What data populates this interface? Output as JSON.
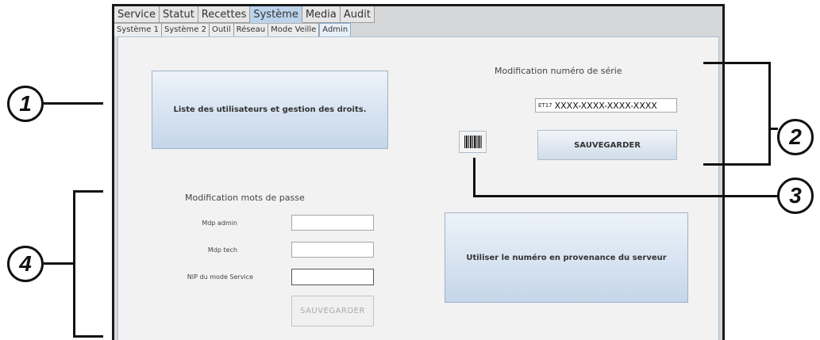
{
  "main_tabs": [
    {
      "label": "Service"
    },
    {
      "label": "Statut"
    },
    {
      "label": "Recettes"
    },
    {
      "label": "Système"
    },
    {
      "label": "Media"
    },
    {
      "label": "Audit"
    }
  ],
  "sub_tabs": [
    {
      "label": "Système 1"
    },
    {
      "label": "Système 2"
    },
    {
      "label": "Outil"
    },
    {
      "label": "Réseau"
    },
    {
      "label": "Mode Veille"
    },
    {
      "label": "Admin"
    }
  ],
  "users_button": {
    "label": "Liste des utilisateurs et gestion des droits."
  },
  "serial": {
    "title": "Modification numéro de série",
    "prefix": "ET17",
    "value": "XXXX-XXXX-XXXX-XXXX",
    "save_label": "SAUVEGARDER"
  },
  "passwords": {
    "title": "Modification mots de passe",
    "admin_label": "Mdp admin",
    "tech_label": "Mdp tech",
    "service_label": "NIP du mode Service",
    "save_label": "SAUVEGARDER"
  },
  "server_button": {
    "label": "Utiliser le numéro en provenance du serveur"
  },
  "callouts": [
    {
      "num": "1"
    },
    {
      "num": "2"
    },
    {
      "num": "3"
    },
    {
      "num": "4"
    }
  ]
}
